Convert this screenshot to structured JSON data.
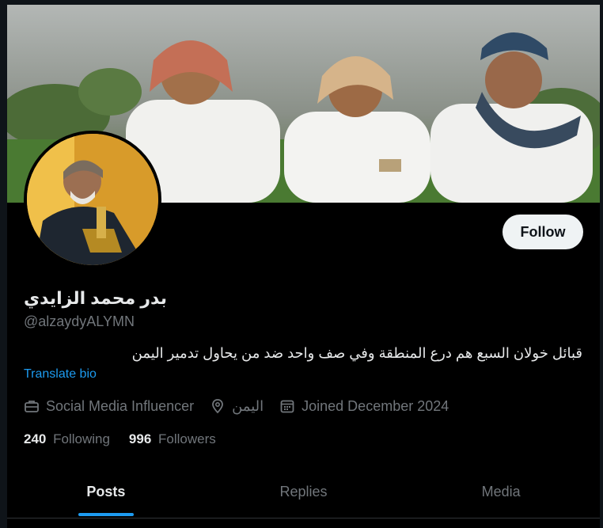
{
  "profile": {
    "display_name": "بدر محمد الزايدي",
    "handle": "@alzaydyALYMN",
    "bio": "قبائل خولان السبع هم درع المنطقة وفي صف واحد ضد من يحاول تدمير اليمن",
    "translate_label": "Translate bio",
    "category": "Social Media Influencer",
    "location": "اليمن",
    "joined": "Joined December 2024"
  },
  "actions": {
    "follow_label": "Follow"
  },
  "stats": {
    "following_count": "240",
    "following_label": "Following",
    "followers_count": "996",
    "followers_label": "Followers"
  },
  "tabs": [
    {
      "label": "Posts",
      "active": true
    },
    {
      "label": "Replies",
      "active": false
    },
    {
      "label": "Media",
      "active": false
    }
  ],
  "icons": {
    "category": "briefcase-icon",
    "location": "location-pin-icon",
    "joined": "calendar-icon"
  },
  "colors": {
    "background": "#000000",
    "text_primary": "#e7e9ea",
    "text_secondary": "#71767b",
    "accent": "#1d9bf0",
    "follow_button_bg": "#eff3f4",
    "follow_button_text": "#0f1419"
  }
}
